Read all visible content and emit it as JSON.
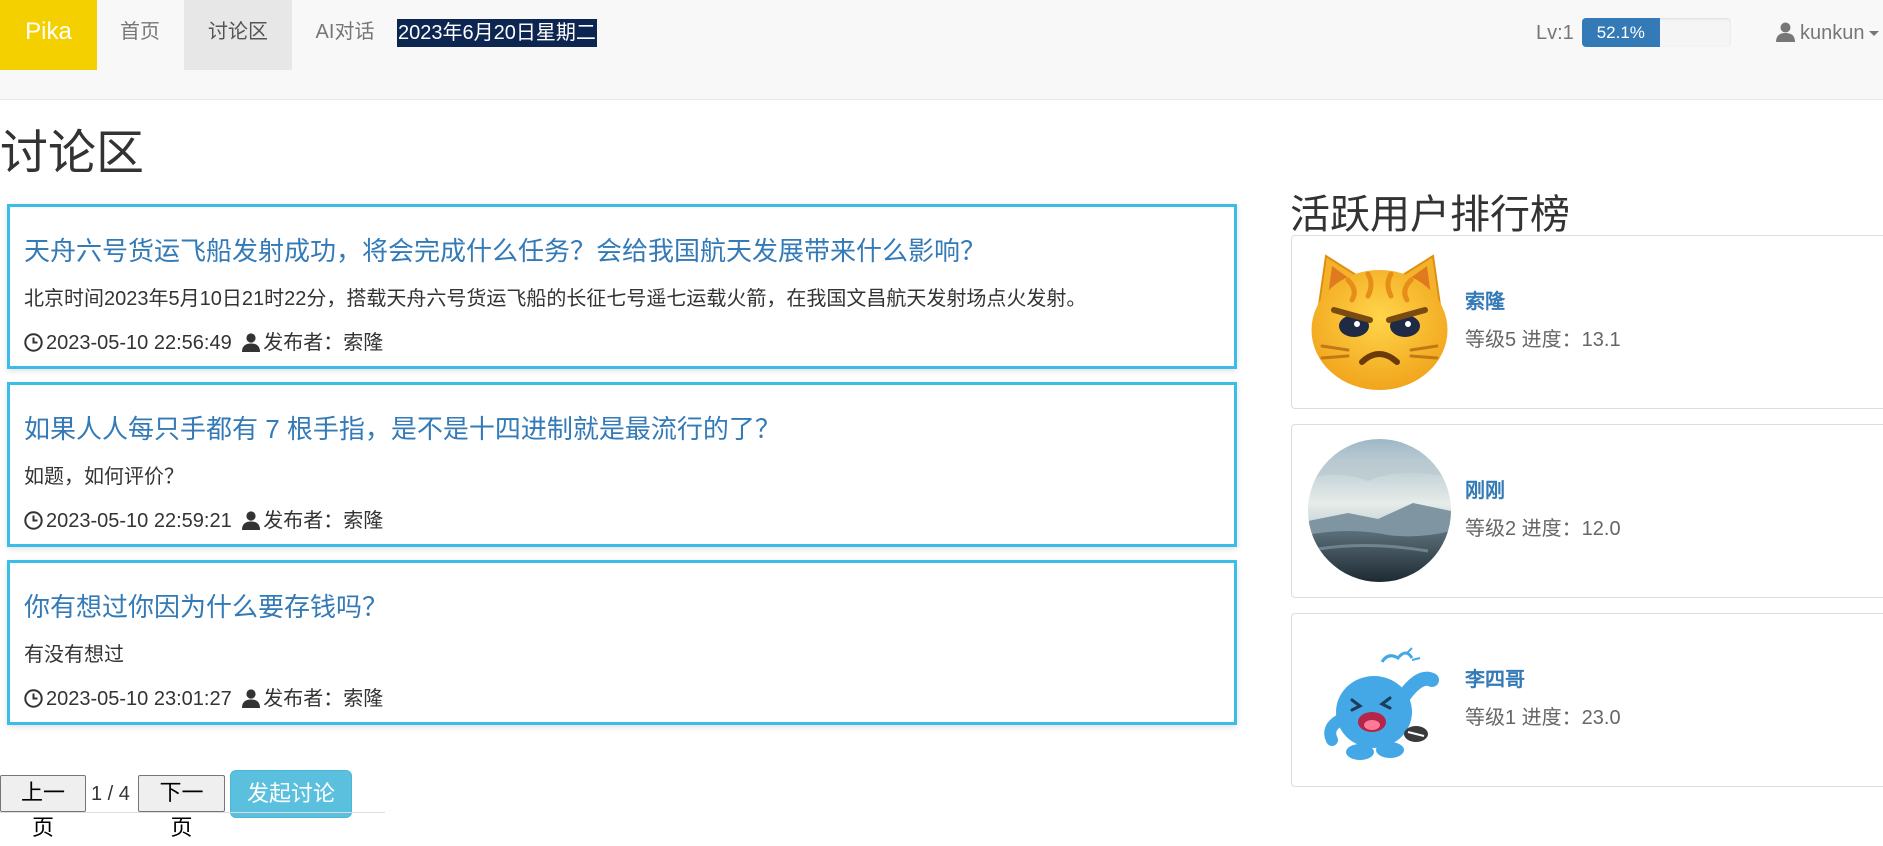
{
  "nav": {
    "brand": "Pika",
    "home": "首页",
    "forum": "讨论区",
    "ai_chat": "AI对话",
    "date": "2023年6月20日星期二",
    "level_label": "Lv:1",
    "progress_text": "52.1%",
    "progress_value": 52.1,
    "username": "kunkun"
  },
  "page": {
    "title": "讨论区"
  },
  "posts": [
    {
      "title": "天舟六号货运飞船发射成功，将会完成什么任务？会给我国航天发展带来什么影响？",
      "summary": "北京时间2023年5月10日21时22分，搭载天舟六号货运飞船的长征七号遥七运载火箭，在我国文昌航天发射场点火发射。",
      "time": "2023-05-10 22:56:49",
      "author": "发布者：索隆"
    },
    {
      "title": "如果人人每只手都有 7 根手指，是不是十四进制就是最流行的了？",
      "summary": "如题，如何评价？",
      "time": "2023-05-10 22:59:21",
      "author": "发布者：索隆"
    },
    {
      "title": "你有想过你因为什么要存钱吗？",
      "summary": "有没有想过",
      "time": "2023-05-10 23:01:27",
      "author": "发布者：索隆"
    }
  ],
  "pager": {
    "prev": "上一页",
    "indicator": "1 / 4",
    "next": "下一页",
    "new_post": "发起讨论"
  },
  "ranking": {
    "title": "活跃用户排行榜",
    "users": [
      {
        "name": "索隆",
        "info": "等级5 进度：13.1",
        "avatar": "angry-cat-avatar"
      },
      {
        "name": "刚刚",
        "info": "等级2 进度：12.0",
        "avatar": "landscape-avatar"
      },
      {
        "name": "李四哥",
        "info": "等级1 进度：23.0",
        "avatar": "blue-cartoon-avatar"
      }
    ]
  },
  "colors": {
    "brand": "#f5d000",
    "link": "#337ab7",
    "post_border": "#3cbde8",
    "progress": "#337ab7",
    "new_button": "#5bc0de"
  }
}
